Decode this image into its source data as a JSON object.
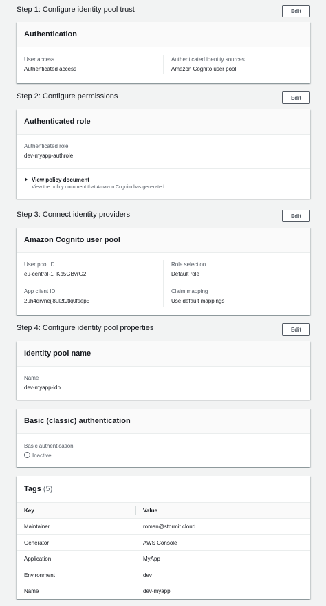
{
  "step1": {
    "title": "Step 1: Configure identity pool trust",
    "edit_label": "Edit",
    "card_title": "Authentication",
    "user_access_label": "User access",
    "user_access_value": "Authenticated access",
    "sources_label": "Authenticated identity sources",
    "sources_value": "Amazon Cognito user pool"
  },
  "step2": {
    "title": "Step 2: Configure permissions",
    "edit_label": "Edit",
    "card_title": "Authenticated role",
    "role_label": "Authenticated role",
    "role_value": "dev-myapp-authrole",
    "policy_title": "View policy document",
    "policy_desc": "View the policy document that Amazon Cognito has generated."
  },
  "step3": {
    "title": "Step 3: Connect identity providers",
    "edit_label": "Edit",
    "card_title": "Amazon Cognito user pool",
    "pool_id_label": "User pool ID",
    "pool_id_value": "eu-central-1_Kp5GBvrG2",
    "client_id_label": "App client ID",
    "client_id_value": "2uh4qrvnejj8ul2t9tkj0fsep5",
    "role_sel_label": "Role selection",
    "role_sel_value": "Default role",
    "claim_label": "Claim mapping",
    "claim_value": "Use default mappings"
  },
  "step4": {
    "title": "Step 4: Configure identity pool properties",
    "edit_label": "Edit",
    "card_title": "Identity pool name",
    "name_label": "Name",
    "name_value": "dev-myapp-idp"
  },
  "basic_auth": {
    "card_title": "Basic (classic) authentication",
    "label": "Basic authentication",
    "status": "Inactive",
    "status_icon": "inactive-icon"
  },
  "tags": {
    "title": "Tags",
    "count": "(5)",
    "columns": [
      "Key",
      "Value"
    ],
    "rows": [
      {
        "key": "Maintainer",
        "value": "roman@stormit.cloud"
      },
      {
        "key": "Generator",
        "value": "AWS Console"
      },
      {
        "key": "Application",
        "value": "MyApp"
      },
      {
        "key": "Environment",
        "value": "dev"
      },
      {
        "key": "Name",
        "value": "dev-myapp"
      }
    ]
  }
}
